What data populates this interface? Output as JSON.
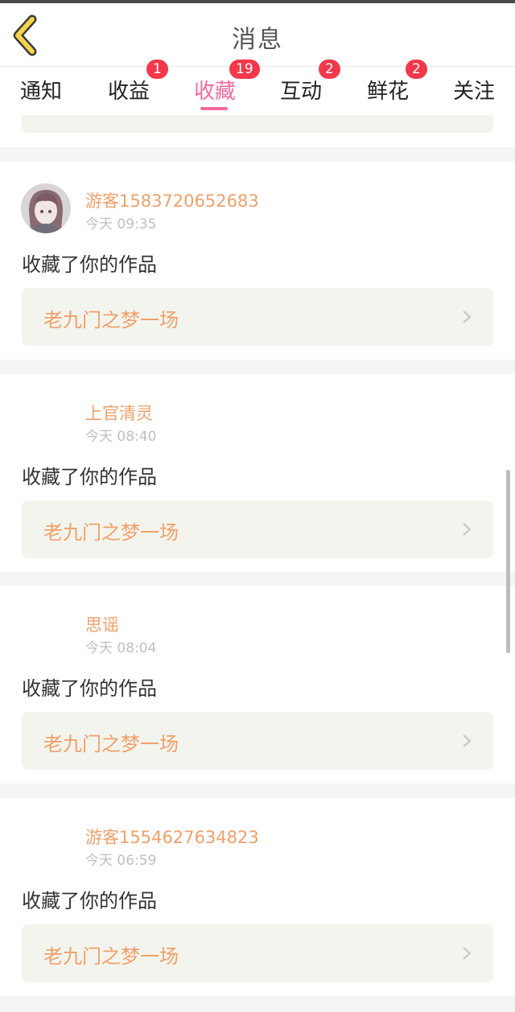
{
  "header": {
    "title": "消息"
  },
  "tabs": [
    {
      "label": "通知",
      "badge": null,
      "active": false
    },
    {
      "label": "收益",
      "badge": "1",
      "active": false
    },
    {
      "label": "收藏",
      "badge": "19",
      "active": true
    },
    {
      "label": "互动",
      "badge": "2",
      "active": false
    },
    {
      "label": "鲜花",
      "badge": "2",
      "active": false
    },
    {
      "label": "关注",
      "badge": null,
      "active": false
    }
  ],
  "messages": [
    {
      "username": "游客1583720652683",
      "time": "今天 09:35",
      "action": "收藏了你的作品",
      "work_title": "老九门之梦一场"
    },
    {
      "username": "上官清灵",
      "time": "今天 08:40",
      "action": "收藏了你的作品",
      "work_title": "老九门之梦一场"
    },
    {
      "username": "思谣",
      "time": "今天 08:04",
      "action": "收藏了你的作品",
      "work_title": "老九门之梦一场"
    },
    {
      "username": "游客1554627634823",
      "time": "今天 06:59",
      "action": "收藏了你的作品",
      "work_title": "老九门之梦一场"
    }
  ],
  "colors": {
    "accent_pink": "#f36aa1",
    "badge_red": "#f2384a",
    "username_orange": "#f0a06a",
    "back_icon_yellow": "#f5d24a"
  },
  "icons": {
    "back": "back-chevron-icon",
    "row_arrow": "chevron-right-icon"
  }
}
